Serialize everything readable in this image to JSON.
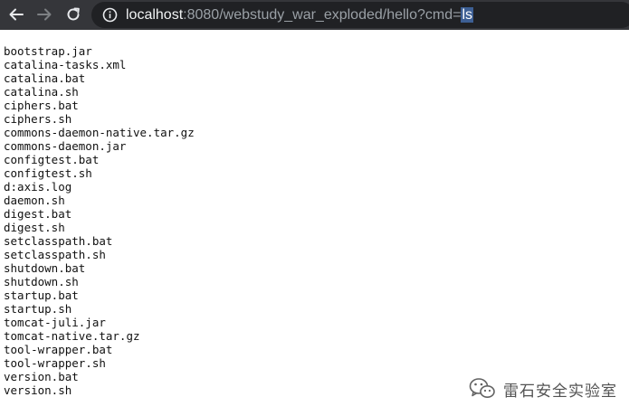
{
  "toolbar": {
    "url_host": "localhost",
    "url_rest": ":8080/webstudy_war_exploded/hello?cmd=",
    "url_selected": "ls"
  },
  "files": [
    "bootstrap.jar",
    "catalina-tasks.xml",
    "catalina.bat",
    "catalina.sh",
    "ciphers.bat",
    "ciphers.sh",
    "commons-daemon-native.tar.gz",
    "commons-daemon.jar",
    "configtest.bat",
    "configtest.sh",
    "d:axis.log",
    "daemon.sh",
    "digest.bat",
    "digest.sh",
    "setclasspath.bat",
    "setclasspath.sh",
    "shutdown.bat",
    "shutdown.sh",
    "startup.bat",
    "startup.sh",
    "tomcat-juli.jar",
    "tomcat-native.tar.gz",
    "tool-wrapper.bat",
    "tool-wrapper.sh",
    "version.bat",
    "version.sh"
  ],
  "watermark": {
    "text": "雷石安全实验室"
  },
  "icons": {
    "back": "back-arrow-icon",
    "forward": "forward-arrow-icon",
    "reload": "reload-icon",
    "info": "info-icon",
    "wechat": "wechat-logo-icon"
  }
}
